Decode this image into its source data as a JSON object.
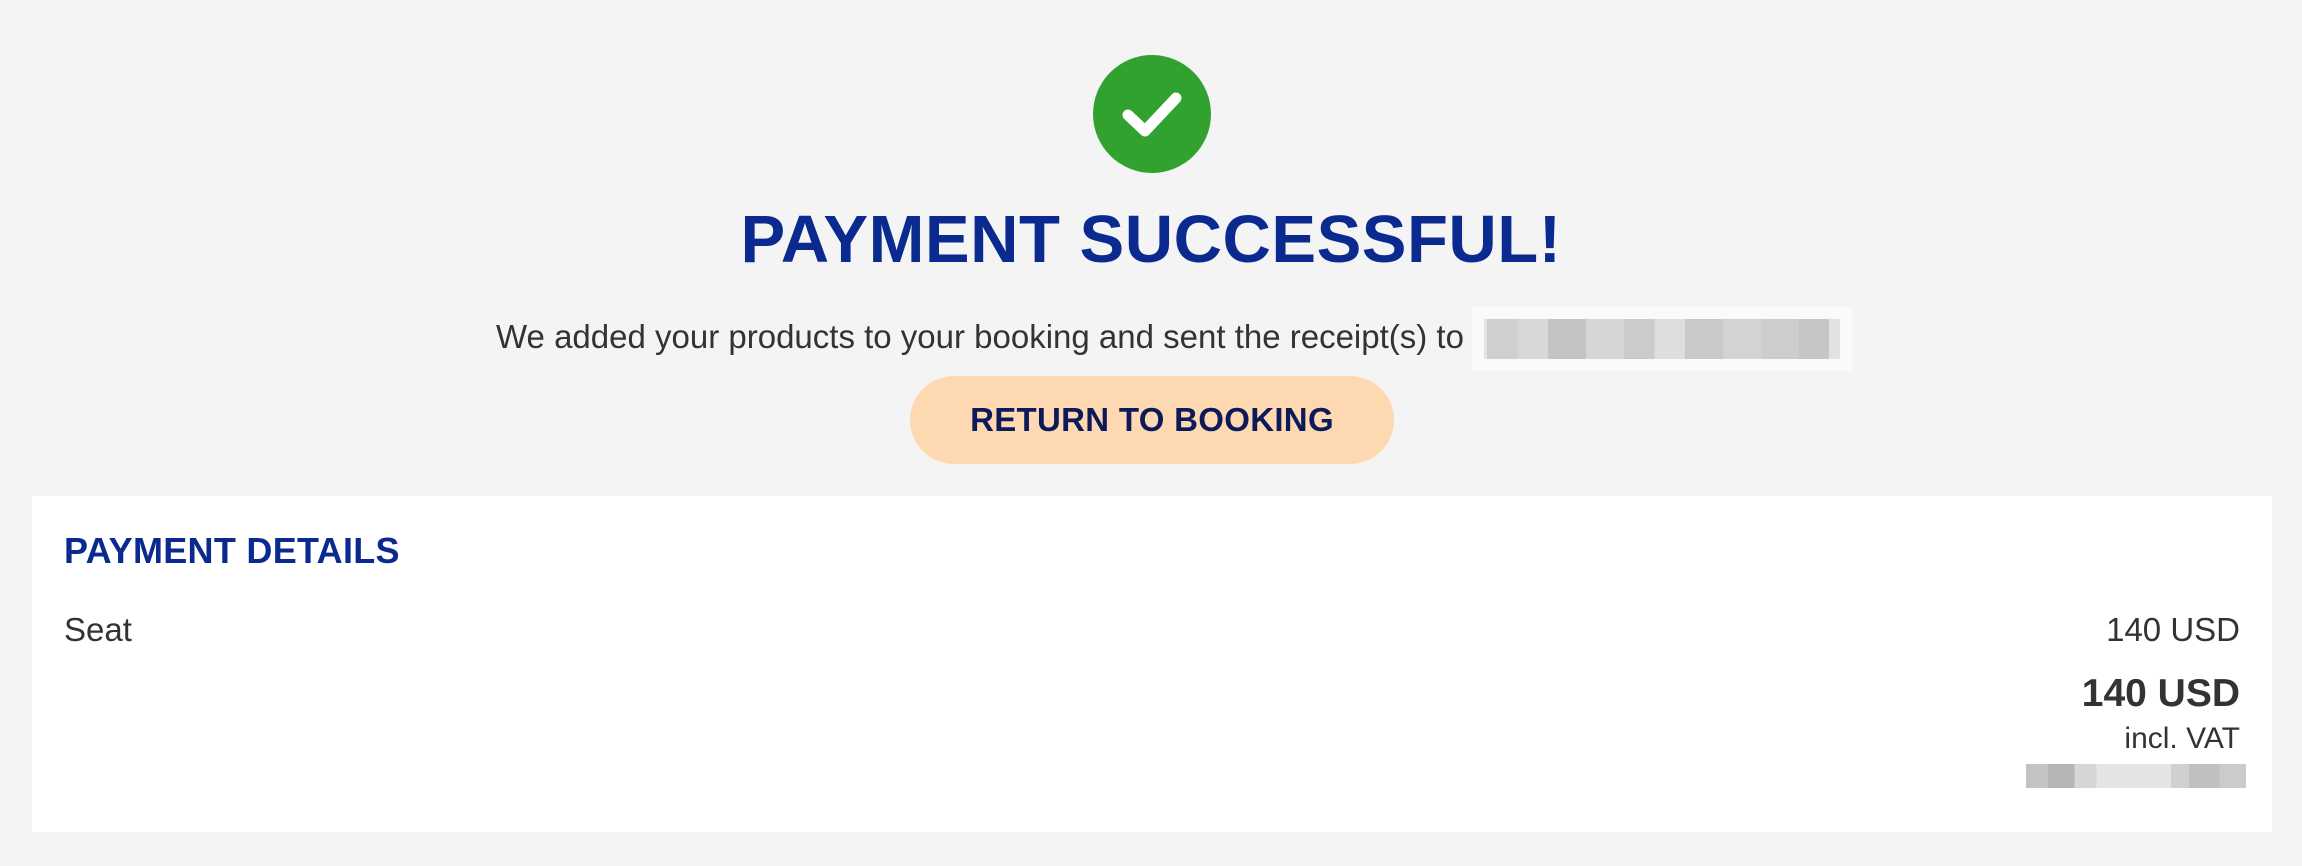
{
  "status": {
    "icon": "checkmark-icon",
    "icon_color": "#31a22f",
    "headline": "PAYMENT SUCCESSFUL!",
    "message": "We added your products to your booking and sent the receipt(s) to"
  },
  "actions": {
    "return_label": "RETURN TO BOOKING"
  },
  "payment_details": {
    "title": "PAYMENT DETAILS",
    "items": [
      {
        "name": "Seat",
        "price": "140 USD"
      }
    ],
    "total": "140 USD",
    "vat_note": "incl. VAT"
  },
  "colors": {
    "brand_blue": "#0a2a8f",
    "button_bg": "#fed8b0",
    "button_text": "#0c1a5a",
    "page_bg": "#f4f4f4"
  }
}
